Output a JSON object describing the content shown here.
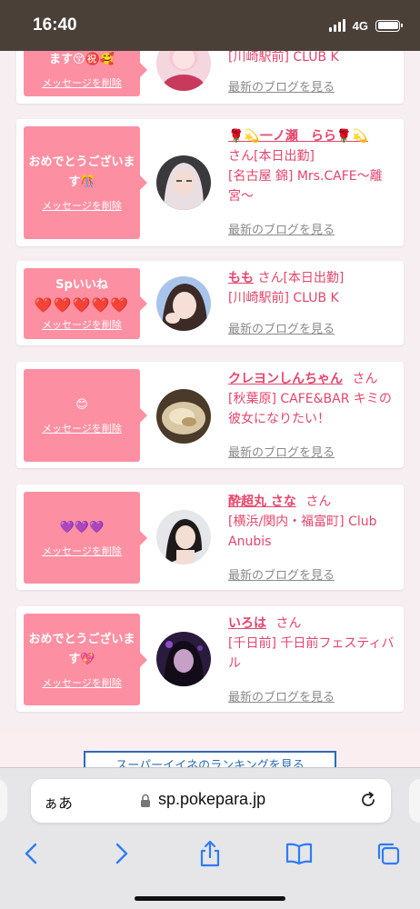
{
  "status_bar": {
    "time": "16:40",
    "network": "4G"
  },
  "browser": {
    "address_prefix": "ぁあ",
    "url": "sp.pokepara.jp"
  },
  "colors": {
    "accent_pink": "#fd8fa2",
    "name_pink": "#e5456b",
    "link_gray": "#8a8a8a",
    "ios_blue": "#2f7cf6"
  },
  "cards": [
    {
      "message": "ます😚㊗️🥰",
      "delete_label": "メッセージを削除",
      "name": "",
      "honorific": "",
      "shop": "[川崎駅前] CLUB K",
      "blog_label": "最新のブログを見る"
    },
    {
      "message": "おめでとうございます🎊",
      "delete_label": "メッセージを削除",
      "name": "🌹💫一ノ瀬　らら🌹💫",
      "honorific": "さん[本日出勤]",
      "shop": "[名古屋 錦] Mrs.CAFE〜離宮〜",
      "blog_label": "最新のブログを見る"
    },
    {
      "message": "Spいいね",
      "message2": "❤️❤️❤️❤️❤️",
      "delete_label": "メッセージを削除",
      "name": "もも",
      "honorific": "さん[本日出勤]",
      "shop": "[川崎駅前] CLUB K",
      "blog_label": "最新のブログを見る"
    },
    {
      "message": "😊",
      "delete_label": "メッセージを削除",
      "name": "クレヨンしんちゃん",
      "honorific": "さん",
      "shop": "[秋葉原] CAFE&BAR キミの彼女になりたい！",
      "blog_label": "最新のブログを見る"
    },
    {
      "message": "💜💜💜",
      "delete_label": "メッセージを削除",
      "name": "酔超丸 さな",
      "honorific": "さん",
      "shop": "[横浜/関内・福富町] Club Anubis",
      "blog_label": "最新のブログを見る"
    },
    {
      "message": "おめでとうございます💖",
      "delete_label": "メッセージを削除",
      "name": "いろは",
      "honorific": "さん",
      "shop": "[千日前] 千日前フェスティバル",
      "blog_label": "最新のブログを見る"
    }
  ],
  "ranking_button": "スーパーイイネのランキングを見る"
}
